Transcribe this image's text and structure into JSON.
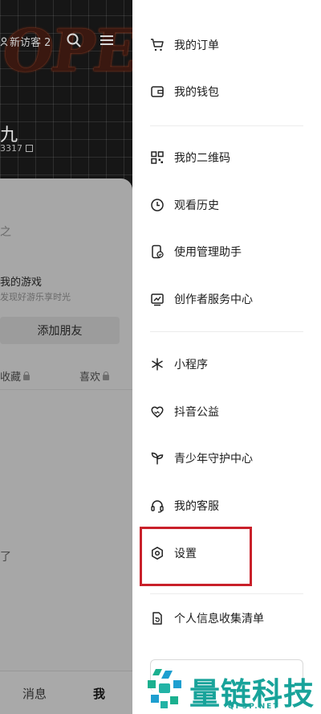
{
  "profile": {
    "hero_text": "OPEN",
    "visitor_label": "新访客 2",
    "username": "九",
    "user_id": "3317",
    "bio": "之",
    "game_title": "我的游戏",
    "game_subtitle": "发现好游乐享时光",
    "add_friend": "添加朋友",
    "tabs": {
      "favorites": "收藏",
      "likes": "喜欢"
    },
    "empty_text": "了"
  },
  "bottom_nav": {
    "messages": "消息",
    "me": "我"
  },
  "drawer": {
    "items": [
      {
        "label": "我的订单",
        "icon": "cart-icon"
      },
      {
        "label": "我的钱包",
        "icon": "wallet-icon"
      },
      {
        "label": "我的二维码",
        "icon": "qrcode-icon"
      },
      {
        "label": "观看历史",
        "icon": "clock-icon"
      },
      {
        "label": "使用管理助手",
        "icon": "phone-check-icon"
      },
      {
        "label": "创作者服务中心",
        "icon": "chart-icon"
      },
      {
        "label": "小程序",
        "icon": "asterisk-icon"
      },
      {
        "label": "抖音公益",
        "icon": "heart-icon"
      },
      {
        "label": "青少年守护中心",
        "icon": "sprout-icon"
      },
      {
        "label": "我的客服",
        "icon": "headset-icon"
      },
      {
        "label": "设置",
        "icon": "settings-icon"
      },
      {
        "label": "个人信息收集清单",
        "icon": "doc-refresh-icon"
      }
    ]
  },
  "watermark": {
    "text": "量链科技",
    "sub": "QFSP.NET"
  },
  "colors": {
    "highlight": "#c9202a",
    "watermark": "#18a39a"
  }
}
